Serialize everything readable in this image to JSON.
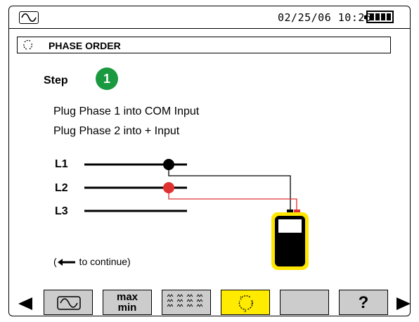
{
  "status_bar": {
    "datetime": "02/25/06 10:26",
    "mode_icon": "waveform-icon",
    "battery_icon": "battery-full-icon"
  },
  "section": {
    "title": "PHASE ORDER",
    "icon": "phase-order-icon"
  },
  "step": {
    "label": "Step",
    "number": "1"
  },
  "instructions": [
    "Plug Phase 1 into COM Input",
    "Plug Phase 2 into + Input"
  ],
  "lines": [
    "L1",
    "L2",
    "L3"
  ],
  "continue_hint": {
    "prefix": "(",
    "text": " to continue)"
  },
  "function_keys": {
    "maxmin_line1": "max",
    "maxmin_line2": "min",
    "help_label": "?"
  },
  "colors": {
    "step_badge": "#1a9940",
    "active_key": "#ffeb00",
    "probe_red": "#e03030",
    "probe_black": "#000000",
    "meter_body": "#ffe600"
  }
}
